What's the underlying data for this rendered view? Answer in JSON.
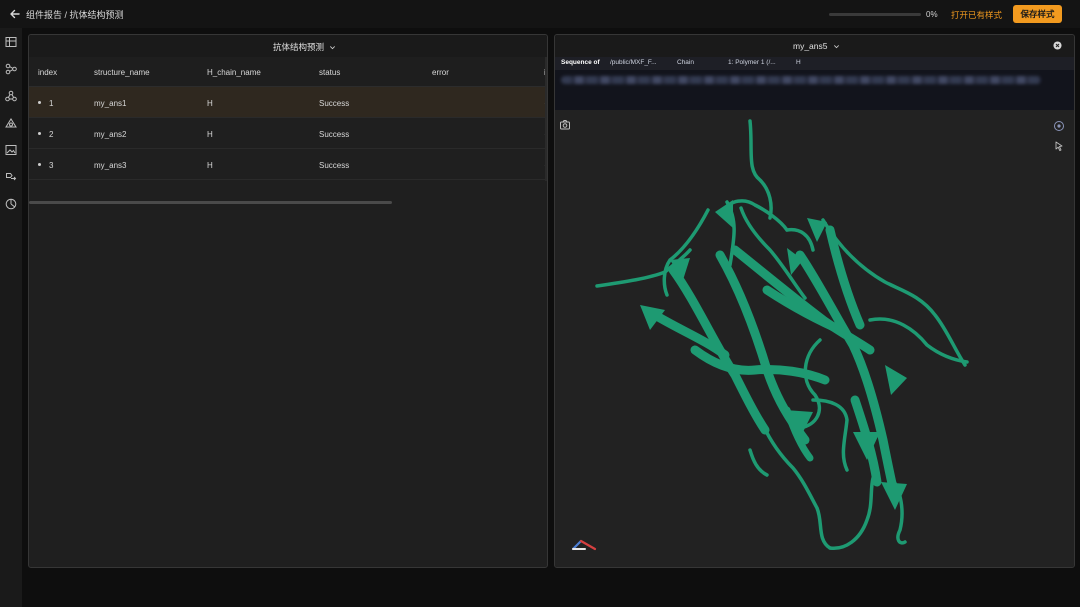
{
  "topbar": {
    "breadcrumb": "组件报告 / 抗体结构预测",
    "progress": {
      "percent": 0,
      "label": "0%"
    },
    "open_style_label": "打开已有样式",
    "save_style_label": "保存样式",
    "accent_color": "#f29a1f"
  },
  "sidebar": {
    "icons": [
      "table-icon",
      "flow-icon",
      "molecule-icon",
      "shape-icon",
      "image-icon",
      "pipeline-icon",
      "pie-icon"
    ]
  },
  "left_panel": {
    "title": "抗体结构预测",
    "columns": [
      "index",
      "structure_name",
      "H_chain_name",
      "status",
      "error",
      "i"
    ],
    "rows": [
      {
        "index": "1",
        "structure_name": "my_ans1",
        "H_chain_name": "H",
        "status": "Success",
        "error": "",
        "extra": "·"
      },
      {
        "index": "2",
        "structure_name": "my_ans2",
        "H_chain_name": "H",
        "status": "Success",
        "error": "",
        "extra": "·"
      },
      {
        "index": "3",
        "structure_name": "my_ans3",
        "H_chain_name": "H",
        "status": "Success",
        "error": "",
        "extra": "·"
      }
    ],
    "selected_row": 0
  },
  "right_panel": {
    "title": "my_ans5",
    "sequence_bar": {
      "label": "Sequence of",
      "path": "/public/MXF_F...",
      "chain_label": "Chain",
      "polymer": "1: Polymer 1 (/...",
      "chain_value": "H"
    },
    "ribbon_color": "#1e9a72"
  }
}
